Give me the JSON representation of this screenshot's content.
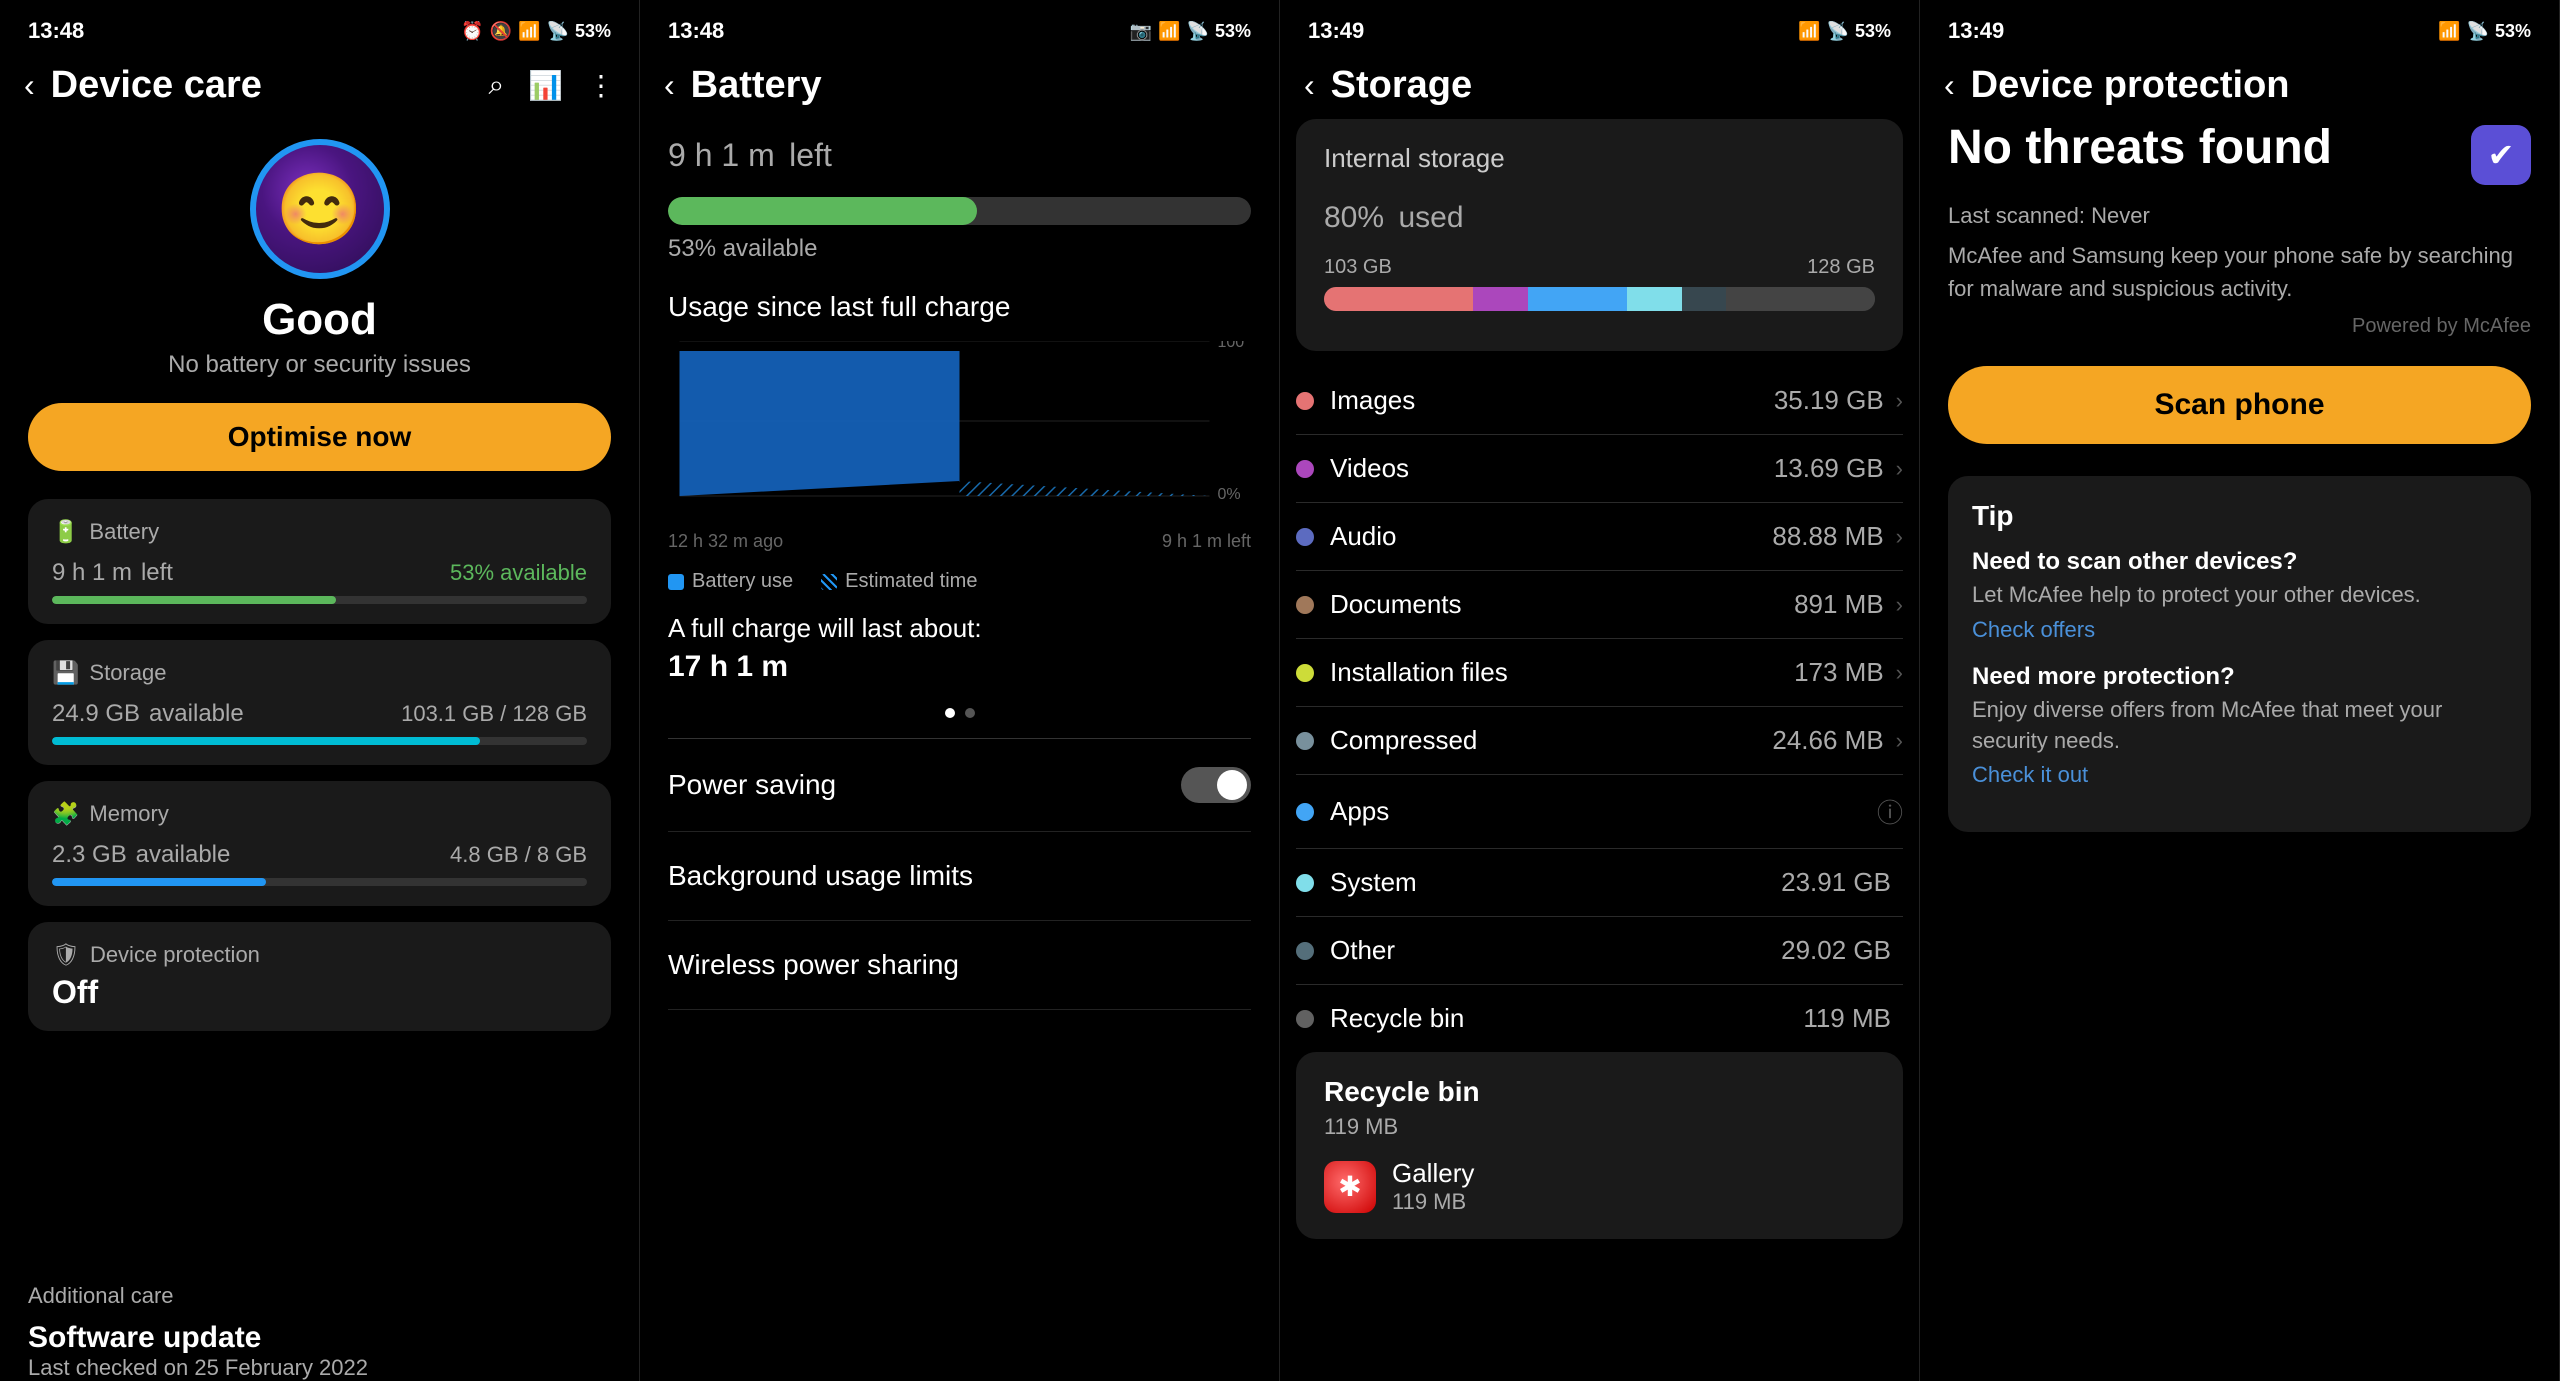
{
  "panel1": {
    "status_bar": {
      "time": "13:48",
      "battery": "53%"
    },
    "nav": {
      "back": "‹",
      "title": "Device care",
      "search": "⌕",
      "menu": "⋮"
    },
    "status_icon": "😊",
    "status_text": "Good",
    "status_subtitle": "No battery or security issues",
    "optimise_btn": "Optimise now",
    "battery": {
      "label": "Battery",
      "icon": "🔋",
      "main": "9 h 1 m",
      "suffix": "left",
      "secondary": "53% available",
      "bar_pct": 53
    },
    "storage": {
      "label": "Storage",
      "icon": "💾",
      "main": "24.9 GB",
      "suffix": "available",
      "detail1": "103.1 GB",
      "detail2": "128 GB",
      "bar_pct": 80
    },
    "memory": {
      "label": "Memory",
      "icon": "🧩",
      "main": "2.3 GB",
      "suffix": "available",
      "detail1": "4.8 GB",
      "detail2": "8 GB",
      "bar_pct": 40
    },
    "device_protection": {
      "label": "Device protection",
      "icon": "🛡",
      "main": "Off"
    },
    "additional_care": {
      "label": "Additional care",
      "item_title": "Software update",
      "item_sub": "Last checked on 25 February 2022"
    }
  },
  "panel2": {
    "status_bar": {
      "time": "13:48",
      "battery": "53%"
    },
    "nav": {
      "back": "‹",
      "title": "Battery"
    },
    "battery_time": "9 h 1 m",
    "battery_time_suffix": "left",
    "battery_pct": 53,
    "battery_available": "53% available",
    "usage_title": "Usage since last full charge",
    "chart_y_max": "100",
    "chart_y_min": "0%",
    "chart_x_left": "12 h 32 m ago",
    "chart_x_right": "9 h 1 m left",
    "legend_battery": "Battery use",
    "legend_estimated": "Estimated time",
    "full_charge_label": "A full charge will last about:",
    "full_charge_val": "17 h 1 m",
    "power_saving_label": "Power saving",
    "background_limits_label": "Background usage limits",
    "wireless_power_label": "Wireless power sharing"
  },
  "panel3": {
    "status_bar": {
      "time": "13:49",
      "battery": "53%"
    },
    "nav": {
      "back": "‹",
      "title": "Storage"
    },
    "internal_storage_label": "Internal storage",
    "used_pct": "80%",
    "used_suffix": "used",
    "bar_left": "103 GB",
    "bar_right": "128 GB",
    "items": [
      {
        "label": "Images",
        "value": "35.19 GB",
        "color": "#E57373",
        "has_arrow": true
      },
      {
        "label": "Videos",
        "value": "13.69 GB",
        "color": "#AB47BC",
        "has_arrow": true
      },
      {
        "label": "Audio",
        "value": "88.88 MB",
        "color": "#5C6BC0",
        "has_arrow": true
      },
      {
        "label": "Documents",
        "value": "891 MB",
        "color": "#A0785A",
        "has_arrow": true
      },
      {
        "label": "Installation files",
        "value": "173 MB",
        "color": "#CDDC39",
        "has_arrow": true
      },
      {
        "label": "Compressed",
        "value": "24.66 MB",
        "color": "#78909C",
        "has_arrow": true
      },
      {
        "label": "Apps",
        "value": "",
        "color": "#42A5F5",
        "has_info": true
      },
      {
        "label": "System",
        "value": "23.91 GB",
        "color": "#80DEEA",
        "has_arrow": false
      },
      {
        "label": "Other",
        "value": "29.02 GB",
        "color": "#546E7A",
        "has_arrow": false
      },
      {
        "label": "Recycle bin",
        "value": "119 MB",
        "color": "#616161",
        "has_arrow": false
      }
    ],
    "recycle_bin": {
      "title": "Recycle bin",
      "subtitle": "119 MB",
      "app_name": "Gallery",
      "app_size": "119 MB"
    }
  },
  "panel4": {
    "status_bar": {
      "time": "13:49",
      "battery": "53%"
    },
    "nav": {
      "back": "‹",
      "title": "Device protection"
    },
    "protection_title": "No threats found",
    "last_scanned": "Last scanned: Never",
    "description": "McAfee and Samsung keep your phone safe by searching for malware and suspicious activity.",
    "powered_by": "Powered by McAfee",
    "scan_btn": "Scan phone",
    "tip_title": "Tip",
    "tip1_title": "Need to scan other devices?",
    "tip1_desc": "Let McAfee help to protect your other devices.",
    "tip1_link": "Check offers",
    "tip2_title": "Need more protection?",
    "tip2_desc": "Enjoy diverse offers from McAfee that meet your security needs.",
    "tip2_link": "Check it out"
  }
}
